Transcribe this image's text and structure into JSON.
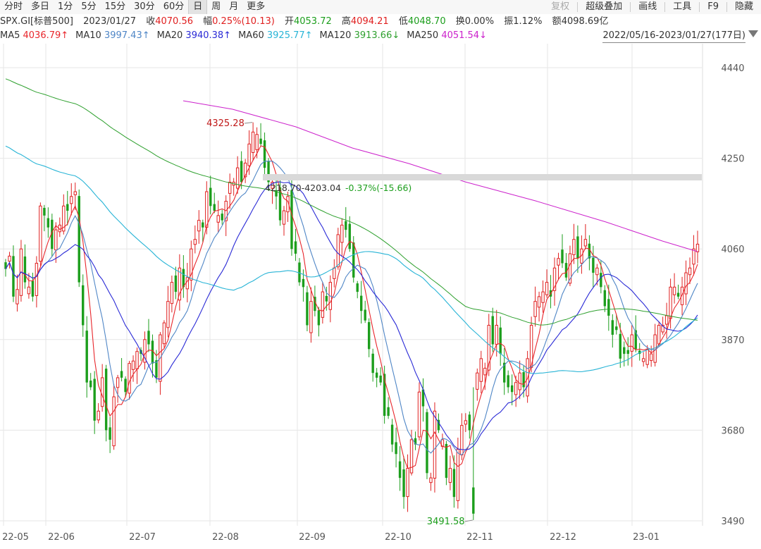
{
  "toolbar": {
    "tabs": [
      "分时",
      "多日",
      "1分",
      "5分",
      "15分",
      "30分",
      "60分",
      "日",
      "周",
      "月",
      "更多"
    ],
    "active": "日",
    "right": [
      {
        "label": "复权",
        "muted": true
      },
      {
        "label": "超级叠加",
        "muted": false
      },
      {
        "label": "画线",
        "muted": false
      },
      {
        "label": "工具",
        "muted": false
      },
      {
        "label": "F9",
        "muted": false
      },
      {
        "label": "隐藏",
        "muted": false
      }
    ]
  },
  "info": {
    "ticker": "SPX.GI[标普500]",
    "date": "2023/01/27",
    "close_label": "收",
    "close": "4070.56",
    "change_label": "幅",
    "change": "0.25%(10.13)",
    "open_label": "开",
    "open": "4053.72",
    "high_label": "高",
    "high": "4094.21",
    "low_label": "低",
    "low": "4048.70",
    "turnover_label": "换",
    "turnover": "0.00%",
    "amplitude_label": "振",
    "amplitude": "1.12%",
    "amount_label": "额",
    "amount": "4098.69亿"
  },
  "ma": [
    {
      "name": "MA5",
      "value": "4036.79↑",
      "color": "#e8262b"
    },
    {
      "name": "MA10",
      "value": "3997.43↑",
      "color": "#4f86c6"
    },
    {
      "name": "MA20",
      "value": "3940.38↑",
      "color": "#2a2ad6"
    },
    {
      "name": "MA60",
      "value": "3925.77↑",
      "color": "#28b4d6"
    },
    {
      "name": "MA120",
      "value": "3913.66↓",
      "color": "#2ea02e"
    },
    {
      "name": "MA250",
      "value": "4051.54↓",
      "color": "#cc22cc"
    }
  ],
  "range_label": "2022/05/16-2023/01/27(177日)",
  "colors": {
    "up": "#e02020",
    "down": "#1c9e1c",
    "grid": "#e6e6e6"
  },
  "chart_data": {
    "type": "candlestick",
    "yticks": [
      4440,
      4250,
      4060,
      3870,
      3680,
      3490
    ],
    "ylim": [
      3475,
      4480
    ],
    "xticks": [
      "22-05",
      "22-06",
      "22-07",
      "22-08",
      "22-09",
      "22-10",
      "22-11",
      "22-12",
      "23-01"
    ],
    "high_marker": "4325.28",
    "low_marker": "3491.58",
    "measure_label": "4218.70-4203.04",
    "measure_change": "-0.37%(-15.66)",
    "closes": [
      4018,
      4045,
      3960,
      3975,
      4060,
      3990,
      3980,
      3960,
      4030,
      4150,
      4130,
      4105,
      4060,
      4100,
      4110,
      4150,
      4140,
      4170,
      4180,
      3990,
      3900,
      3780,
      3770,
      3700,
      3720,
      3790,
      3680,
      3660,
      3750,
      3790,
      3790,
      3760,
      3820,
      3825,
      3845,
      3840,
      3870,
      3860,
      3820,
      3790,
      3880,
      3905,
      3950,
      3990,
      3970,
      4020,
      3980,
      4000,
      4060,
      4080,
      4120,
      4105,
      4180,
      4150,
      4140,
      4130,
      4120,
      4160,
      4200,
      4200,
      4230,
      4200,
      4240,
      4280,
      4280,
      4300,
      4280,
      4230,
      4200,
      4200,
      4170,
      4120,
      4140,
      4170,
      4060,
      4050,
      3990,
      3980,
      3900,
      3950,
      3930,
      3900,
      3970,
      3950,
      3990,
      4020,
      4090,
      4110,
      4100,
      4060,
      4000,
      3970,
      3930,
      3910,
      3850,
      3800,
      3790,
      3780,
      3710,
      3710,
      3650,
      3630,
      3580,
      3540,
      3600,
      3660,
      3650,
      3760,
      3730,
      3590,
      3580,
      3720,
      3680,
      3660,
      3580,
      3600,
      3540,
      3640,
      3690,
      3700,
      3680,
      3760,
      3800,
      3830,
      3810,
      3900,
      3860,
      3900,
      3840,
      3780,
      3770,
      3760,
      3780,
      3800,
      3770,
      3830,
      3900,
      3950,
      3960,
      3970,
      3990,
      3960,
      4020,
      4040,
      4030,
      4000,
      4050,
      4080,
      4040,
      4060,
      4080,
      4040,
      4010,
      4020,
      3980,
      3940,
      3920,
      3880,
      3890,
      3830,
      3840,
      3840,
      3880,
      3850,
      3840,
      3830,
      3850,
      3840,
      3880,
      3900,
      3900,
      3920,
      3980,
      3980,
      3960,
      3980,
      4010,
      4020,
      4060,
      4070
    ],
    "ma250_points": [
      [
        260,
        143
      ],
      [
        330,
        155
      ],
      [
        420,
        180
      ],
      [
        500,
        210
      ],
      [
        580,
        232
      ],
      [
        660,
        258
      ],
      [
        760,
        285
      ],
      [
        860,
        315
      ],
      [
        940,
        342
      ],
      [
        990,
        357
      ]
    ]
  }
}
